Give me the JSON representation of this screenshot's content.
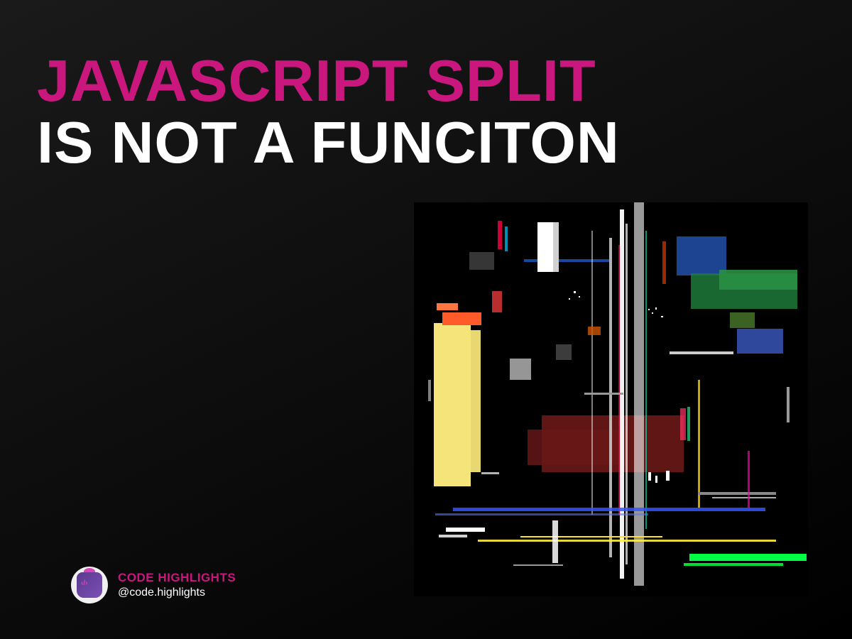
{
  "headline": {
    "line1": "JAVASCRIPT SPLIT",
    "line2": "IS NOT A FUNCITON"
  },
  "credit": {
    "name": "CODE HIGHLIGHTS",
    "handle": "@code.highlights"
  },
  "colors": {
    "accent": "#c9177e",
    "background_start": "#1a1a1a",
    "background_end": "#000000",
    "text_primary": "#ffffff"
  }
}
